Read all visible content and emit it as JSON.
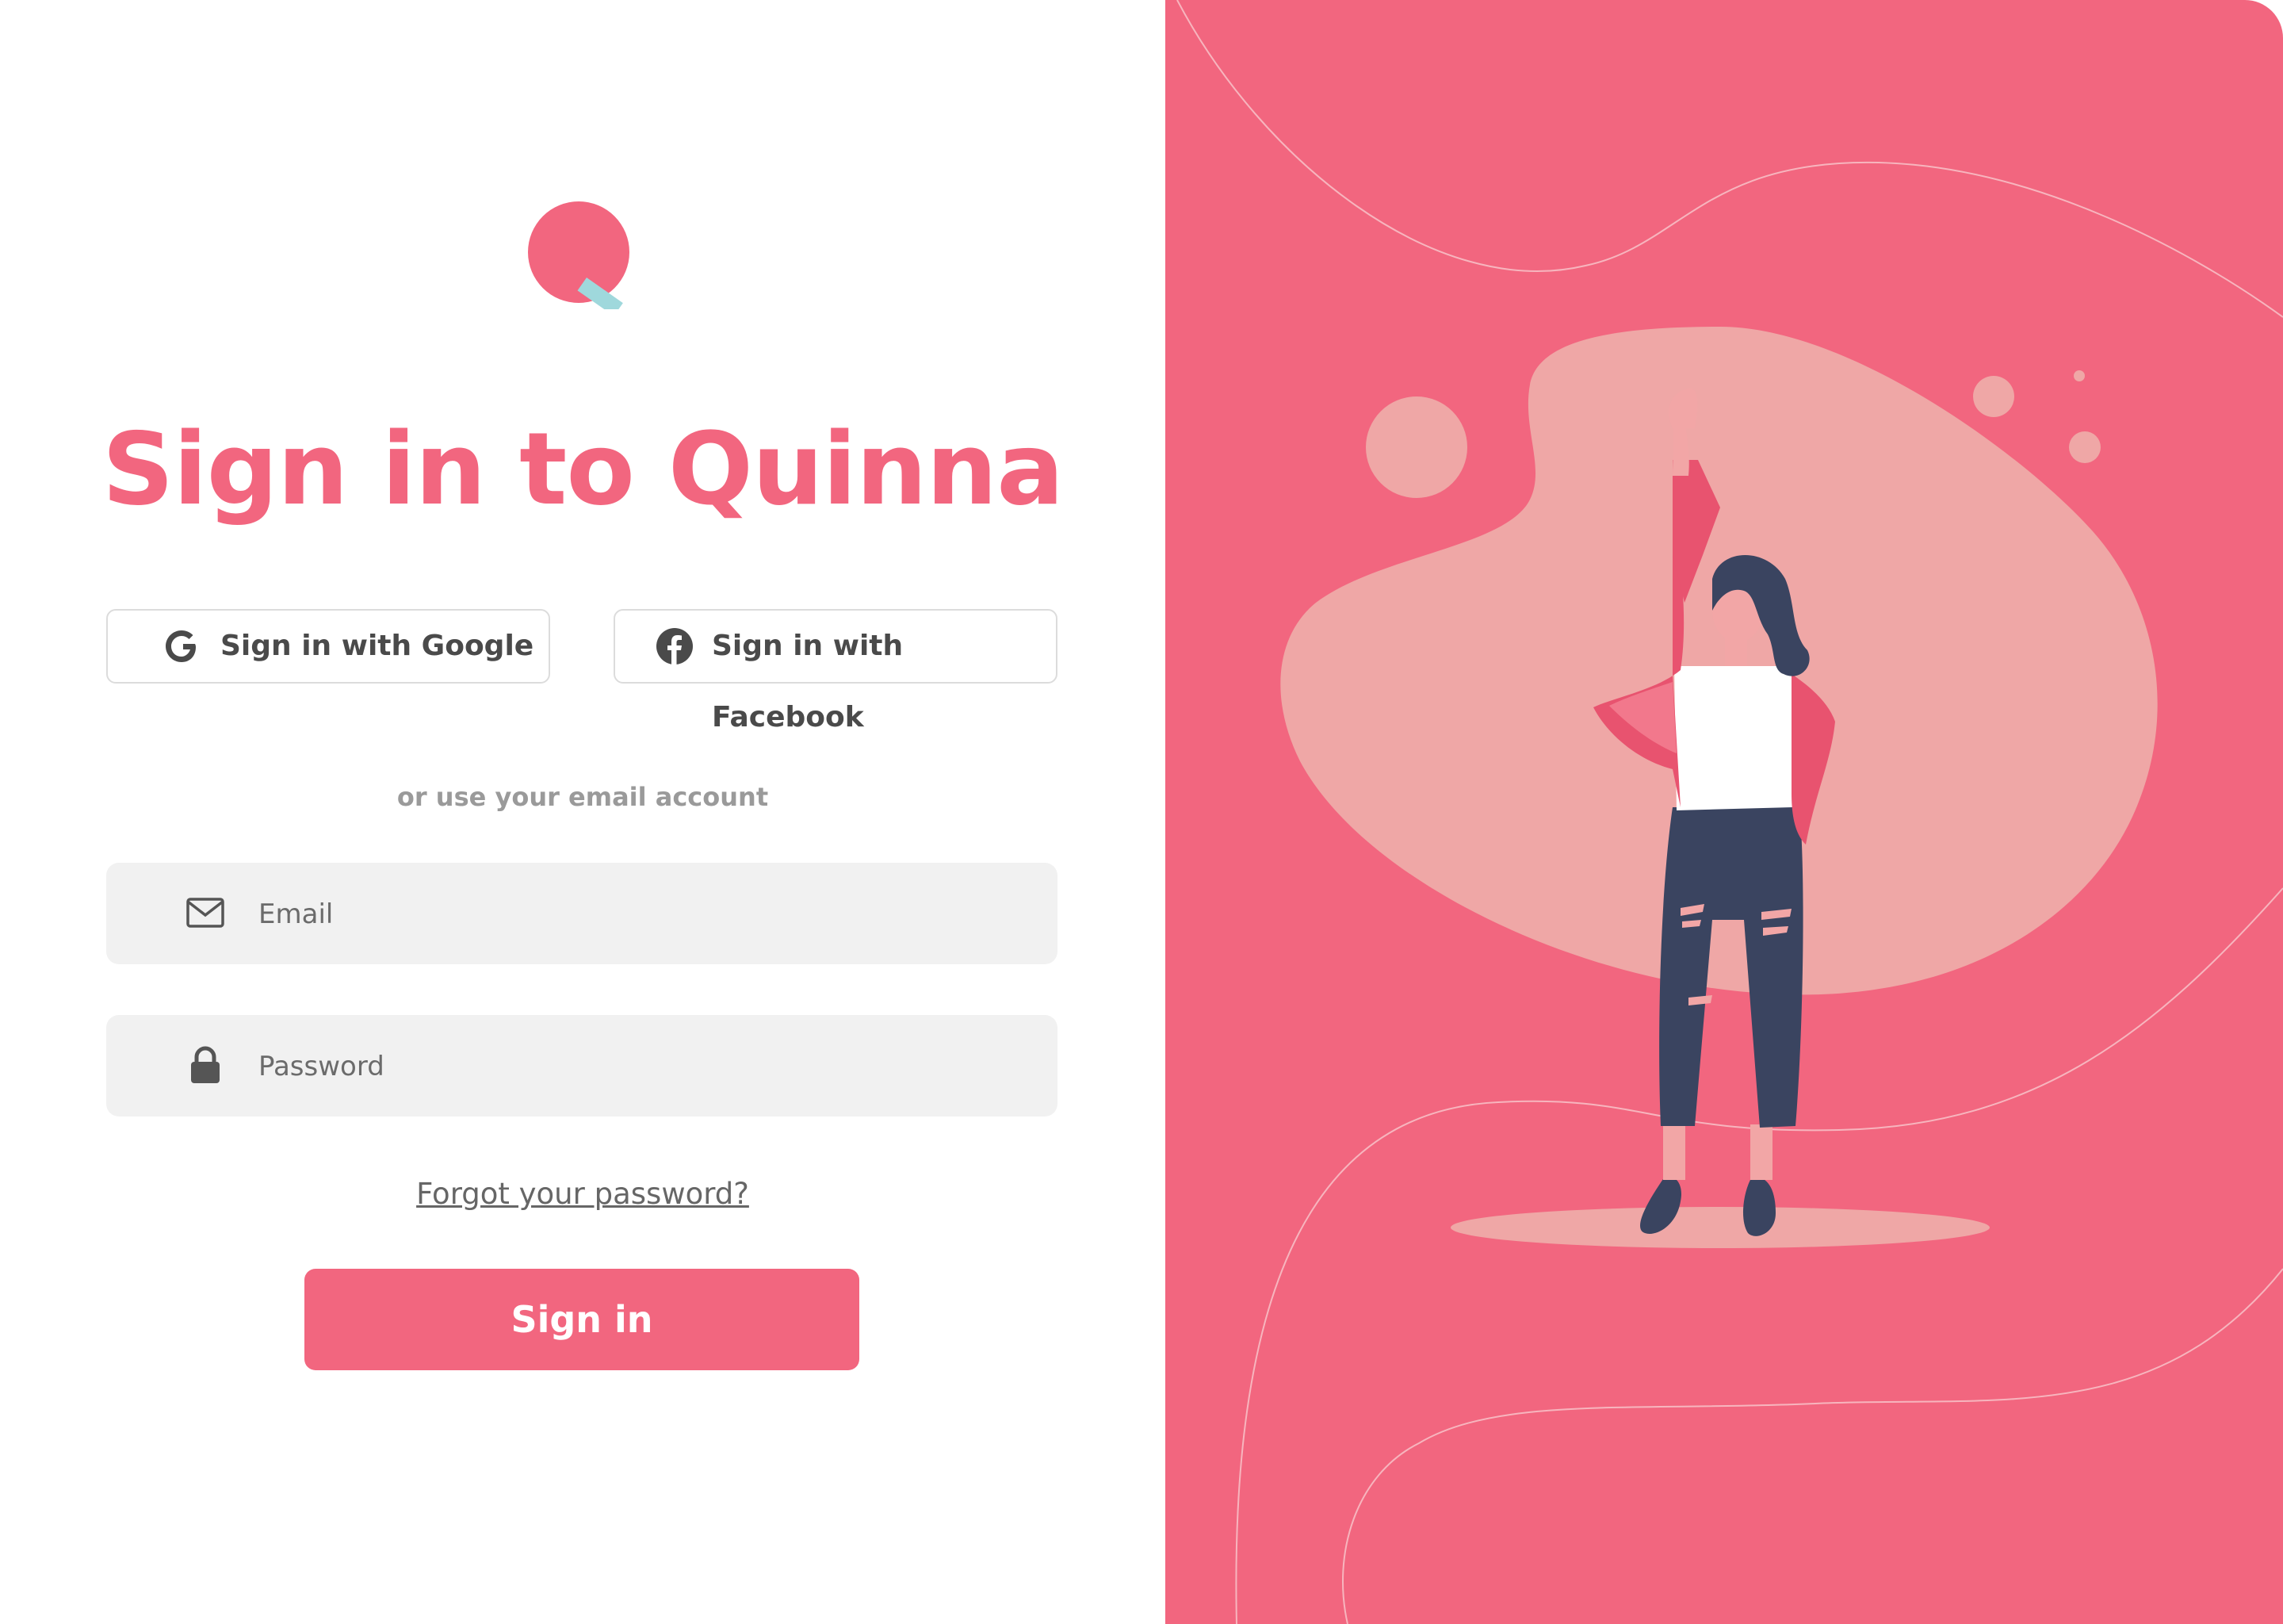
{
  "brand": {
    "logo_icon": "quinna-logo-icon",
    "primary_color": "#f2667f",
    "accent_color": "#9fd8dc"
  },
  "signin": {
    "title": "Sign in to Quinna",
    "google_label": "Sign in with Google",
    "google_icon": "google-icon",
    "facebook_label": "Sign in with Facebook",
    "facebook_icon": "facebook-icon",
    "divider_text": "or use your email account",
    "email_placeholder": "Email",
    "email_icon": "envelope-icon",
    "password_placeholder": "Password",
    "password_icon": "lock-icon",
    "forgot_label": "Forgot your password?",
    "submit_label": "Sign in"
  },
  "illustration": {
    "subject": "woman-raising-hand-illustration",
    "background_color": "#f2667f",
    "blob_color": "#efa7a6"
  }
}
